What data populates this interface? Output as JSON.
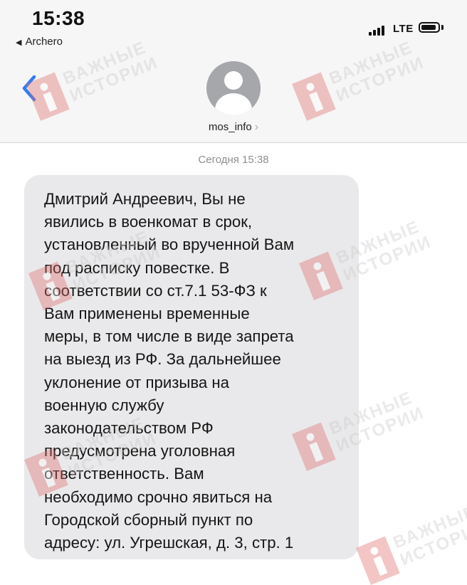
{
  "status_bar": {
    "time": "15:38",
    "back_app": "Archero",
    "network": "LTE"
  },
  "header": {
    "contact_name": "mos_info"
  },
  "conversation": {
    "timestamp": "Сегодня 15:38",
    "message_lines": [
      "Дмитрий Андреевич, Вы не",
      "явились в военкомат в срок,",
      "установленный во врученной Вам",
      "под расписку повестке. В",
      "соответствии со ст.7.1 53-ФЗ к",
      "Вам применены временные",
      "меры, в том числе в виде запрета",
      "на выезд из РФ. За дальнейшее",
      "уклонение от призыва на",
      "военную службу",
      "законодательством РФ",
      "предусмотрена уголовная",
      "ответственность. Вам",
      "необходимо срочно явиться на",
      "Городской сборный пункт по",
      "адресу: ул. Угрешская, д. 3, стр. 1"
    ]
  },
  "watermark": {
    "line1": "ВАЖНЫЕ",
    "line2": "ИСТОРИИ",
    "logo_color": "#e06a6a"
  },
  "colors": {
    "accent": "#2f7cf6",
    "bubble": "#e9e9eb",
    "avatar": "#a6a7ab"
  }
}
